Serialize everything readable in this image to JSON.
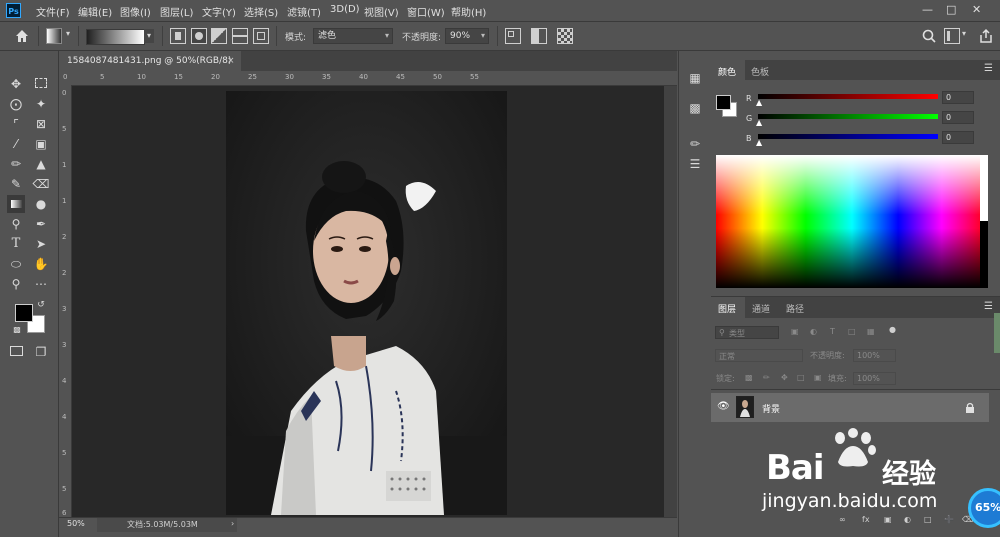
{
  "menu": {
    "logo": "Ps",
    "items": [
      "文件(F)",
      "编辑(E)",
      "图像(I)",
      "图层(L)",
      "文字(Y)",
      "选择(S)",
      "滤镜(T)",
      "3D(D)",
      "视图(V)",
      "窗口(W)",
      "帮助(H)"
    ],
    "window_controls": [
      "—",
      "□",
      "✕"
    ]
  },
  "options": {
    "mode_label": "模式:",
    "mode_value": "滤色",
    "opacity_label": "不透明度:",
    "opacity_value": "90%"
  },
  "document": {
    "tab_title": "1584087481431.png @ 50%(RGB/8)",
    "tab_close": "×",
    "ruler_h_labels": [
      "0",
      "5",
      "10",
      "15",
      "20",
      "25",
      "30",
      "35",
      "40",
      "45",
      "50",
      "55"
    ],
    "ruler_v_labels": [
      "0",
      "5",
      "1",
      "1",
      "2",
      "2",
      "3",
      "3",
      "4",
      "4",
      "5",
      "5",
      "6"
    ],
    "zoom": "50%",
    "doc_info": "文档:5.03M/5.03M"
  },
  "color_panel": {
    "tabs": [
      "颜色",
      "色板"
    ],
    "channels": [
      {
        "label": "R",
        "value": "0",
        "color": "#ff0000"
      },
      {
        "label": "G",
        "value": "0",
        "color": "#00ff00"
      },
      {
        "label": "B",
        "value": "0",
        "color": "#0000ff"
      }
    ],
    "foreground": "#000000",
    "background": "#ffffff"
  },
  "layers_panel": {
    "tabs": [
      "图层",
      "通道",
      "路径"
    ],
    "search_placeholder": "类型",
    "blend_mode": "正常",
    "opacity_label": "不透明度:",
    "opacity_value": "100%",
    "lock_label": "锁定:",
    "fill_label": "填充:",
    "fill_value": "100%",
    "layers": [
      {
        "name": "背景",
        "visible": true,
        "locked": true
      }
    ]
  },
  "watermark": {
    "brand_latin": "Bai",
    "brand_cn": "经验",
    "url": "jingyan.baidu.com"
  },
  "badge": {
    "percent": "65%"
  }
}
